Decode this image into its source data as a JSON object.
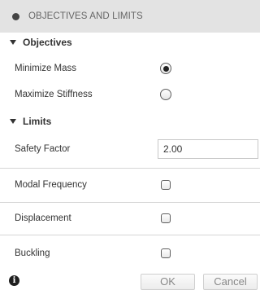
{
  "panel": {
    "title": "OBJECTIVES AND LIMITS"
  },
  "objectives": {
    "heading": "Objectives",
    "options": [
      {
        "label": "Minimize Mass",
        "selected": true
      },
      {
        "label": "Maximize Stiffness",
        "selected": false
      }
    ]
  },
  "limits": {
    "heading": "Limits",
    "safety_factor_label": "Safety Factor",
    "safety_factor_value": "2.00",
    "modal_frequency_label": "Modal Frequency",
    "modal_frequency_checked": false,
    "displacement_label": "Displacement",
    "displacement_checked": false,
    "buckling_label": "Buckling",
    "buckling_checked": false
  },
  "footer": {
    "info_icon": "info-icon",
    "info_glyph": "i",
    "ok_label": "OK",
    "cancel_label": "Cancel"
  }
}
